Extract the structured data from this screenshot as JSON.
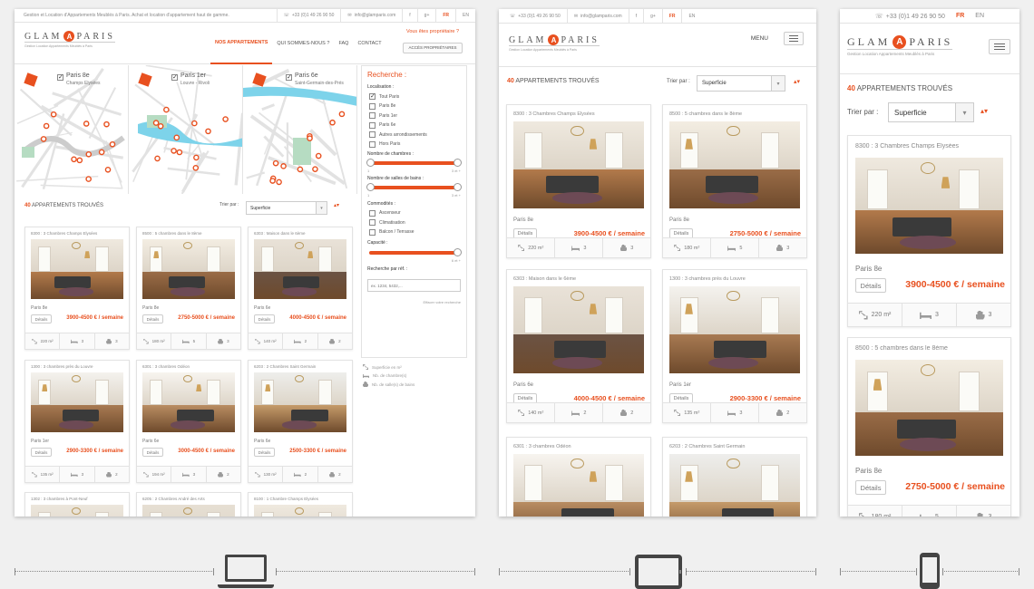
{
  "brand": {
    "logo_left": "GLAM",
    "logo_letter": "A",
    "logo_right": "PARIS",
    "tagline": "Gestion Location Appartements Meublés à Paris"
  },
  "topbar": {
    "intro": "Gestion et Location d'Appartements Meublés à Paris. Achat et location d'appartement haut de gamme.",
    "phone": "+33 (0)1 49 26 90 50",
    "email": "info@glamparis.com",
    "facebook": "f",
    "googleplus": "g+",
    "lang_fr": "FR",
    "lang_en": "EN"
  },
  "nav": {
    "items": [
      "NOS APPARTEMENTS",
      "QUI SOMMES-NOUS ?",
      "FAQ",
      "CONTACT"
    ],
    "owner_question": "Vous êtes propriétaire ?",
    "owner_button": "ACCÈS PROPRIÉTAIRES",
    "menu_label": "MENU"
  },
  "maps": [
    {
      "label": "Paris 8e",
      "sub": "Champs Elysées"
    },
    {
      "label": "Paris 1er",
      "sub": "Louvre - Rivoli"
    },
    {
      "label": "Paris 6e",
      "sub": "Saint-Germain-des-Prés"
    }
  ],
  "results": {
    "count": "40",
    "label": " APPARTEMENTS TROUVÉS",
    "sort_label": "Trier par :",
    "sort_value": "Superficie"
  },
  "search": {
    "title": "Recherche :",
    "loc_label": "Localisation :",
    "locations": [
      {
        "label": "Tout Paris",
        "checked": true
      },
      {
        "label": "Paris 8e",
        "checked": false
      },
      {
        "label": "Paris 1er",
        "checked": false
      },
      {
        "label": "Paris 6e",
        "checked": false
      },
      {
        "label": "Autres arrondissements",
        "checked": false
      },
      {
        "label": "Hors Paris",
        "checked": false
      }
    ],
    "rooms_label": "Nombre de chambres :",
    "rooms_min": "1",
    "rooms_max": "3 et +",
    "baths_label": "Nombre de salles de bains :",
    "baths_min": "1",
    "baths_max": "3 et +",
    "comfort_label": "Commodités :",
    "comforts": [
      {
        "label": "Ascenseur",
        "checked": false
      },
      {
        "label": "Climatisation",
        "checked": false
      },
      {
        "label": "Balcon / Terrasse",
        "checked": false
      }
    ],
    "capacity_label": "Capacité :",
    "capacity_max": "6 et +",
    "ref_label": "Recherche par réf. :",
    "ref_placeholder": "ex. 1234, 5432,...",
    "clear": "Effacer votre recherche",
    "legend": [
      "Superficie en m²",
      "Nb. de chambre(s)",
      "Nb. de salle(s) de bains"
    ]
  },
  "details_label": "Détails",
  "listings": [
    {
      "title": "8300 : 3 Chambres Champs Elysées",
      "district": "Paris 8e",
      "price": "3900-4500 € / semaine",
      "area": "220 m²",
      "beds": "3",
      "baths": "3"
    },
    {
      "title": "8500 : 5 chambres dans le 8ème",
      "district": "Paris 8e",
      "price": "2750-5000 € / semaine",
      "area": "180 m²",
      "beds": "5",
      "baths": "3"
    },
    {
      "title": "6303 : Maison dans le 6ème",
      "district": "Paris 6e",
      "price": "4000-4500 € / semaine",
      "area": "140 m²",
      "beds": "2",
      "baths": "2"
    },
    {
      "title": "1300 : 3 chambres près du Louvre",
      "district": "Paris 1er",
      "price": "2900-3300 € / semaine",
      "area": "135 m²",
      "beds": "3",
      "baths": "2"
    },
    {
      "title": "6301 : 3 chambres Odéon",
      "district": "Paris 6e",
      "price": "3000-4500 € / semaine",
      "area": "194 m²",
      "beds": "3",
      "baths": "2"
    },
    {
      "title": "6203 : 2 Chambres Saint Germain",
      "district": "Paris 6e",
      "price": "2500-3300 € / semaine",
      "area": "130 m²",
      "beds": "2",
      "baths": "2"
    },
    {
      "title": "1302 : 3 chambres à Pont-Neuf",
      "district": "",
      "price": "",
      "area": "",
      "beds": "",
      "baths": ""
    },
    {
      "title": "6205 : 2 Chambres André des Arts",
      "district": "",
      "price": "",
      "area": "",
      "beds": "",
      "baths": ""
    },
    {
      "title": "8100 : 1 Chambre Champs Elysées",
      "district": "",
      "price": "",
      "area": "",
      "beds": "",
      "baths": ""
    }
  ],
  "colors": {
    "accent": "#e8501f",
    "text": "#555555",
    "border": "#e2e2e2"
  }
}
